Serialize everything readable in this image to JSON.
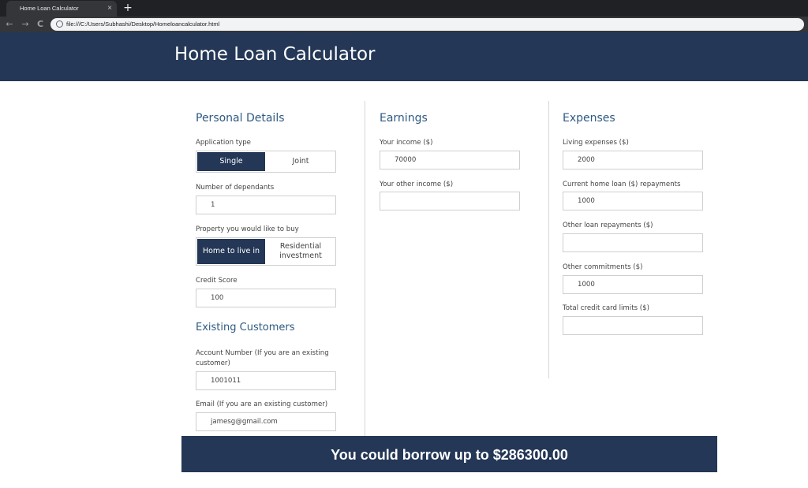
{
  "browser": {
    "tab_title": "Home Loan Calculator",
    "tab_close": "×",
    "new_tab": "+",
    "url": "file:///C:/Users/Subhashi/Desktop/Homeloancalculator.html",
    "back_icon": "←",
    "forward_icon": "→",
    "reload_icon": "C"
  },
  "header": {
    "title": "Home Loan Calculator"
  },
  "personal": {
    "title": "Personal Details",
    "application_type_label": "Application type",
    "application_options": [
      "Single",
      "Joint"
    ],
    "application_selected": "Single",
    "dependants_label": "Number of dependants",
    "dependants_value": "1",
    "property_label": "Property you would like to buy",
    "property_options": [
      "Home to live in",
      "Residential investment"
    ],
    "property_selected": "Home to live in",
    "credit_label": "Credit Score",
    "credit_value": "100"
  },
  "existing": {
    "title": "Existing Customers",
    "account_label": "Account Number (If you are an existing customer)",
    "account_value": "1001011",
    "email_label": "Email (If you are an existing customer)",
    "email_value": "jamesg@gmail.com"
  },
  "earnings": {
    "title": "Earnings",
    "income_label": "Your income ($)",
    "income_value": "70000",
    "other_income_label": "Your other income ($)",
    "other_income_value": ""
  },
  "expenses": {
    "title": "Expenses",
    "living_label": "Living expenses ($)",
    "living_value": "2000",
    "home_loan_label": "Current home loan ($) repayments",
    "home_loan_value": "1000",
    "other_loan_label": "Other loan repayments ($)",
    "other_loan_value": "",
    "commitments_label": "Other commitments ($)",
    "commitments_value": "1000",
    "credit_limit_label": "Total credit card limits ($)",
    "credit_limit_value": ""
  },
  "result": {
    "text": "You could borrow up to $286300.00"
  },
  "colors": {
    "primary": "#243756",
    "heading": "#2e5a82"
  }
}
